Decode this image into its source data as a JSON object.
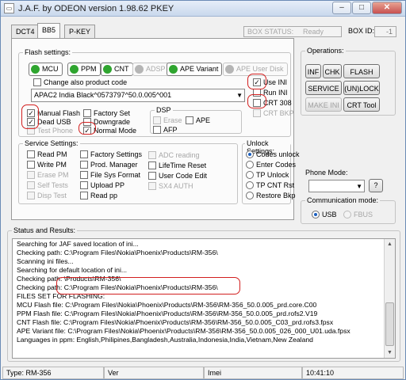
{
  "window": {
    "title": "J.A.F. by ODEON version 1.98.62 PKEY"
  },
  "tabs": [
    "DCT4",
    "BB5",
    "P-KEY"
  ],
  "box_status": {
    "label": "BOX STATUS:",
    "value": "Ready"
  },
  "box_id": {
    "label": "BOX ID:",
    "value": "-1"
  },
  "flash_settings": {
    "title": "Flash settings:",
    "buttons": [
      {
        "label": "MCU",
        "color": "#2fa52f",
        "enabled": true
      },
      {
        "label": "PPM",
        "color": "#2fa52f",
        "enabled": true
      },
      {
        "label": "CNT",
        "color": "#2fa52f",
        "enabled": true
      },
      {
        "label": "ADSP",
        "color": "#b5b5b5",
        "enabled": false
      },
      {
        "label": "APE Variant",
        "color": "#2fa52f",
        "enabled": true
      },
      {
        "label": "APE User Disk",
        "color": "#b5b5b5",
        "enabled": false
      }
    ],
    "change_product_code": "Change also product code",
    "product_code": "APAC2 India Black^0573797^50.0.005^001",
    "use_ini": "Use INI",
    "run_ini": "Run INI",
    "crt_308": "CRT 308",
    "crt_bkp": "CRT BKP",
    "manual_flash": "Manual Flash",
    "dead_usb": "Dead USB",
    "test_phone": "Test Phone",
    "factory_set": "Factory Set",
    "downgrade": "Downgrade",
    "normal_mode": "Normal Mode",
    "dsp": {
      "title": "DSP",
      "erase": "Erase",
      "ape": "APE",
      "afp": "AFP"
    }
  },
  "service_settings": {
    "title": "Service Settings:",
    "col1": [
      {
        "label": "Read PM",
        "enabled": true
      },
      {
        "label": "Write PM",
        "enabled": true
      },
      {
        "label": "Erase PM",
        "enabled": false
      },
      {
        "label": "Self Tests",
        "enabled": false
      },
      {
        "label": "Disp Test",
        "enabled": false
      }
    ],
    "col2": [
      {
        "label": "Factory Settings",
        "enabled": true
      },
      {
        "label": "Prod. Manager",
        "enabled": true
      },
      {
        "label": "File Sys Format",
        "enabled": true
      },
      {
        "label": "Upload PP",
        "enabled": true
      },
      {
        "label": "Read pp",
        "enabled": true
      }
    ],
    "col3": [
      {
        "label": "ADC reading",
        "enabled": false
      },
      {
        "label": "LifeTime Reset",
        "enabled": true
      },
      {
        "label": "User Code Edit",
        "enabled": true
      },
      {
        "label": "SX4 AUTH",
        "enabled": false
      }
    ]
  },
  "unlock_settings": {
    "title": "Unlock Settings:",
    "options": [
      "Codes unlock",
      "Enter Codes",
      "TP Unlock",
      "TP CNT Rst",
      "Restore Bkp"
    ],
    "selected": "Codes unlock"
  },
  "operations": {
    "title": "Operations:",
    "buttons": [
      {
        "label": "INF",
        "enabled": true
      },
      {
        "label": "CHK",
        "enabled": true
      },
      {
        "label": "FLASH",
        "enabled": true
      },
      {
        "label": "SERVICE",
        "enabled": true
      },
      {
        "label": "(UN)LOCK",
        "enabled": true
      },
      {
        "label": "MAKE INI",
        "enabled": false
      },
      {
        "label": "CRT Tool",
        "enabled": true
      }
    ]
  },
  "phone_mode": {
    "title": "Phone Mode:",
    "value": "",
    "help": "?"
  },
  "comm_mode": {
    "title": "Communication mode:",
    "options": [
      "USB",
      "FBUS"
    ],
    "selected": "USB"
  },
  "status_results": {
    "title": "Status and Results:",
    "lines": [
      "Searching for JAF saved location of ini...",
      "Checking path: C:\\Program Files\\Nokia\\Phoenix\\Products\\RM-356\\",
      "Scanning ini files...",
      "Searching for default location of ini...",
      "Checking path: \\Products\\RM-356\\",
      "Checking path: C:\\Program Files\\Nokia\\Phoenix\\Products\\RM-356\\",
      "FILES SET FOR FLASHING:",
      "MCU Flash file: C:\\Program Files\\Nokia\\Phoenix\\Products\\RM-356\\RM-356_50.0.005_prd.core.C00",
      "PPM Flash file: C:\\Program Files\\Nokia\\Phoenix\\Products\\RM-356\\RM-356_50.0.005_prd.rofs2.V19",
      "CNT Flash file: C:\\Program Files\\Nokia\\Phoenix\\Products\\RM-356\\RM-356_50.0.005_C03_prd.rofs3.fpsx",
      "APE Variant file: C:\\Program Files\\Nokia\\Phoenix\\Products\\RM-356\\RM-356_50.0.005_026_000_U01.uda.fpsx",
      "Languages in ppm: English,Philipines,Bangladesh,Australia,Indonesia,India,Vietnam,New Zealand"
    ]
  },
  "statusbar": {
    "type": "Type: RM-356",
    "ver": "Ver",
    "imei": "Imei",
    "time": "10:41:10"
  },
  "icons": [
    "app-icon",
    "minimize-icon",
    "maximize-icon",
    "close-icon",
    "dropdown-arrow-icon",
    "scroll-up-icon",
    "scroll-down-icon"
  ],
  "colors": {
    "active_green": "#2fa52f",
    "annotation_red": "#d21f1f"
  }
}
